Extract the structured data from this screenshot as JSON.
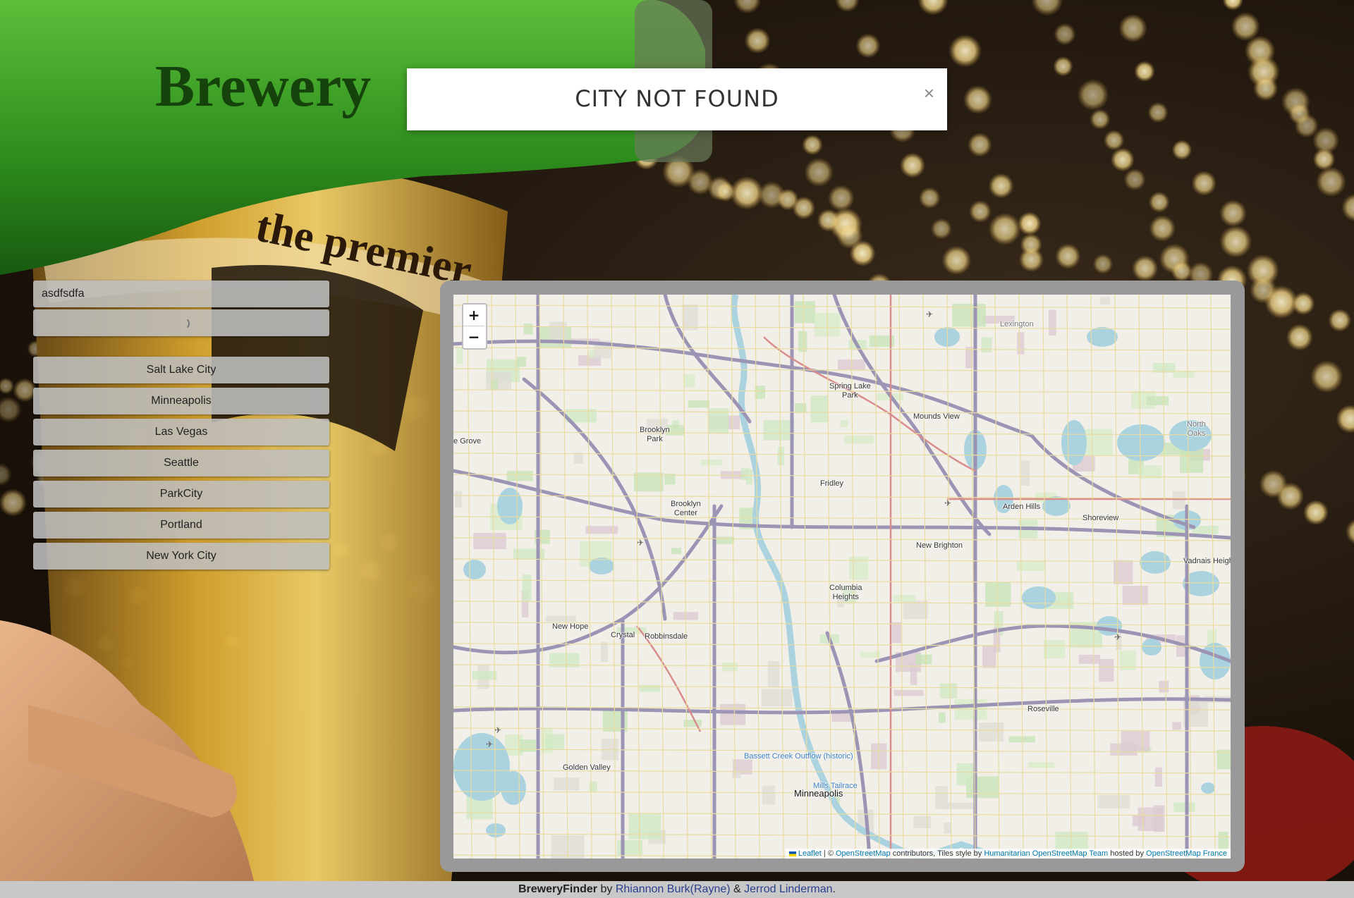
{
  "modal": {
    "title": "CITY NOT FOUND",
    "close_glyph": "×"
  },
  "background_art": {
    "bottle_text": "Brewery",
    "glass_text": "the premier"
  },
  "search": {
    "value": "asdfsdfa"
  },
  "cities": [
    "Salt Lake City",
    "Minneapolis",
    "Las Vegas",
    "Seattle",
    "ParkCity",
    "Portland",
    "New York City"
  ],
  "map": {
    "zoom_in": "+",
    "zoom_out": "−",
    "places": {
      "lexington": "Lexington",
      "spring_lake_park": "Spring Lake\nPark",
      "mounds_view": "Mounds View",
      "north_oaks": "North\nOaks",
      "brooklyn_park": "Brooklyn\nPark",
      "grove": "e Grove",
      "fridley": "Fridley",
      "brooklyn_center": "Brooklyn\nCenter",
      "arden_hills": "Arden Hills",
      "shoreview": "Shoreview",
      "new_brighton": "New Brighton",
      "vadnais_heights": "Vadnais Heigh",
      "columbia_heights": "Columbia\nHeights",
      "new_hope": "New Hope",
      "crystal": "Crystal",
      "robbinsdale": "Robbinsdale",
      "roseville": "Roseville",
      "bassett_creek": "Bassett Creek Outflow (historic)",
      "golden_valley": "Golden Valley",
      "mills_tailrace": "Mills Tailrace",
      "minneapolis": "Minneapolis"
    },
    "attribution": {
      "leaflet": "Leaflet",
      "sep1": " | © ",
      "osm": "OpenStreetMap",
      "mid": " contributors, Tiles style by ",
      "hot": "Humanitarian OpenStreetMap Team",
      "hosted": " hosted by ",
      "osmfr": "OpenStreetMap France"
    }
  },
  "footer": {
    "app": "BreweryFinder",
    "by": " by ",
    "author1": "Rhiannon Burk(Rayne)",
    "amp": " & ",
    "author2": "Jerrod Linderman",
    "end": "."
  },
  "colors": {
    "accent_link": "#0078a8",
    "water": "#aad3df",
    "modal_bg": "#ffffff"
  }
}
